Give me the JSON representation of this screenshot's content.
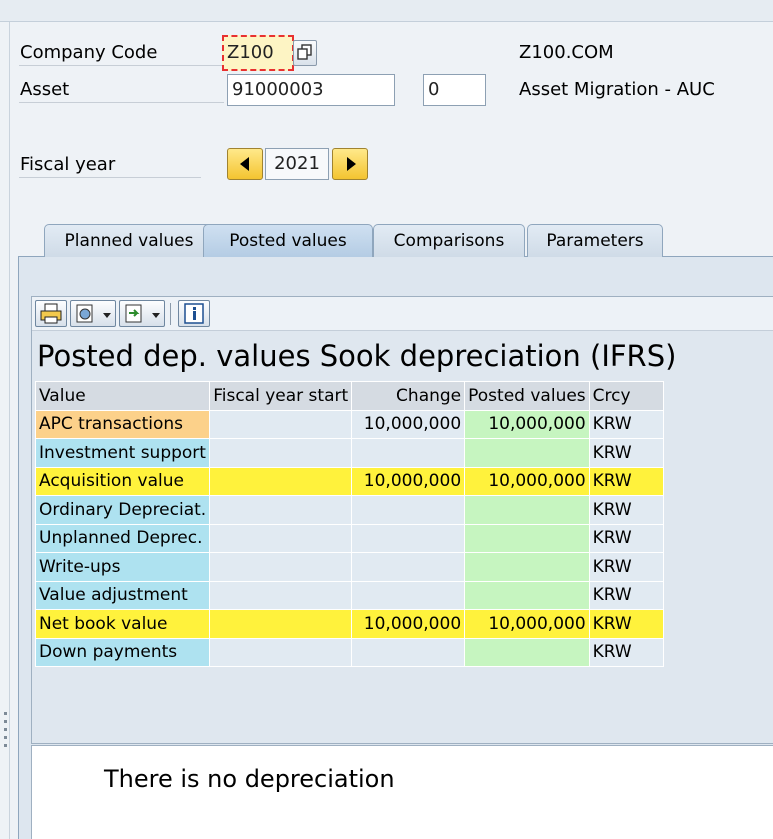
{
  "header": {
    "company_code_label": "Company Code",
    "company_code_value": "Z100",
    "company_name": "Z100.COM",
    "asset_label": "Asset",
    "asset_number": "91000003",
    "asset_subnumber": "0",
    "asset_description": "Asset Migration - AUC",
    "fiscal_year_label": "Fiscal year",
    "fiscal_year_value": "2021"
  },
  "tabs": [
    {
      "label": "Planned values",
      "active": false
    },
    {
      "label": "Posted values",
      "active": true
    },
    {
      "label": "Comparisons",
      "active": false
    },
    {
      "label": "Parameters",
      "active": false
    }
  ],
  "toolbar": {
    "icons": [
      "print-icon",
      "export-icon",
      "layout-icon",
      "info-icon"
    ]
  },
  "grid": {
    "title": "Posted dep. values Sook depreciation (IFRS)",
    "columns": [
      "Value",
      "Fiscal year start",
      "Change",
      "Posted values",
      "Crcy"
    ],
    "rows": [
      {
        "label": "APC transactions",
        "start": "",
        "change": "10,000,000",
        "posted": "10,000,000",
        "crcy": "KRW"
      },
      {
        "label": "Investment support",
        "start": "",
        "change": "",
        "posted": "",
        "crcy": "KRW"
      },
      {
        "label": "Acquisition value",
        "start": "",
        "change": "10,000,000",
        "posted": "10,000,000",
        "crcy": "KRW"
      },
      {
        "label": "Ordinary Depreciat.",
        "start": "",
        "change": "",
        "posted": "",
        "crcy": "KRW"
      },
      {
        "label": "Unplanned Deprec.",
        "start": "",
        "change": "",
        "posted": "",
        "crcy": "KRW"
      },
      {
        "label": "Write-ups",
        "start": "",
        "change": "",
        "posted": "",
        "crcy": "KRW"
      },
      {
        "label": "Value adjustment",
        "start": "",
        "change": "",
        "posted": "",
        "crcy": "KRW"
      },
      {
        "label": "Net book value",
        "start": "",
        "change": "10,000,000",
        "posted": "10,000,000",
        "crcy": "KRW"
      },
      {
        "label": "Down payments",
        "start": "",
        "change": "",
        "posted": "",
        "crcy": "KRW"
      }
    ]
  },
  "message": {
    "text": "There is no depreciation"
  },
  "colors": {
    "total_row": "#fff23c",
    "posted_column": "#c6f5c0",
    "key_column": "#aee2f0",
    "selected_key": "#fcd18a"
  }
}
